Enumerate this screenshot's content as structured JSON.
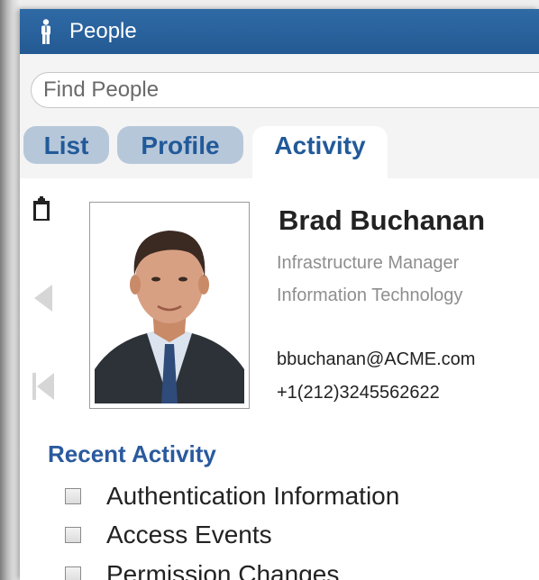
{
  "window": {
    "title": "People"
  },
  "search": {
    "placeholder": "Find People",
    "value": ""
  },
  "tabs": [
    {
      "label": "List",
      "active": false
    },
    {
      "label": "Profile",
      "active": false
    },
    {
      "label": "Activity",
      "active": true
    }
  ],
  "profile": {
    "name": "Brad Buchanan",
    "job_title": "Infrastructure Manager",
    "department": "Information Technology",
    "email": "bbuchanan@ACME.com",
    "phone": "+1(212)3245562622"
  },
  "recent_activity": {
    "heading": "Recent Activity",
    "items": [
      {
        "label": "Authentication Information",
        "checked": false
      },
      {
        "label": "Access Events",
        "checked": false
      },
      {
        "label": "Permission Changes",
        "checked": false
      }
    ]
  },
  "colors": {
    "titlebar": "#2a63a0",
    "tab_inactive": "#b7c7da",
    "accent_text": "#215a99",
    "heading": "#2a5a9e"
  },
  "icons": {
    "title": "person-icon",
    "clipboard": "clipboard-icon",
    "previous": "previous-arrow-icon",
    "first": "first-record-icon"
  }
}
